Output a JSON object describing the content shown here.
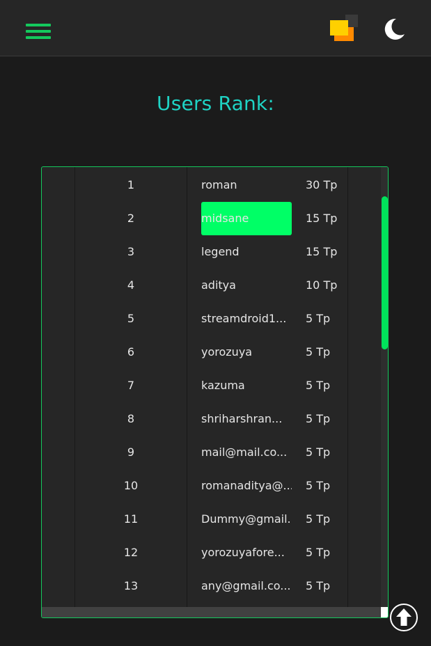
{
  "header": {
    "menu_icon": "hamburger-menu-icon",
    "logo_icon": "stacked-squares-logo",
    "theme_icon": "moon-icon",
    "accent_color": "#14c95d"
  },
  "page": {
    "title": "Users Rank:"
  },
  "leaderboard": {
    "highlight_color": "#00ff66",
    "rows": [
      {
        "rank": "1",
        "name": "roman",
        "points": "30 Tp"
      },
      {
        "rank": "2",
        "name": "midsane",
        "points": "15 Tp"
      },
      {
        "rank": "3",
        "name": "legend",
        "points": "15 Tp"
      },
      {
        "rank": "4",
        "name": "aditya",
        "points": "10 Tp"
      },
      {
        "rank": "5",
        "name": "streamdroid1...",
        "points": "5 Tp"
      },
      {
        "rank": "6",
        "name": "yorozuya",
        "points": "5 Tp"
      },
      {
        "rank": "7",
        "name": "kazuma",
        "points": "5 Tp"
      },
      {
        "rank": "8",
        "name": "shriharshran...",
        "points": "5 Tp"
      },
      {
        "rank": "9",
        "name": "mail@mail.co...",
        "points": "5 Tp"
      },
      {
        "rank": "10",
        "name": "romanaditya@...",
        "points": "5 Tp"
      },
      {
        "rank": "11",
        "name": "Dummy@gmail....",
        "points": "5 Tp"
      },
      {
        "rank": "12",
        "name": "yorozuyafore...",
        "points": "5 Tp"
      },
      {
        "rank": "13",
        "name": "any@gmail.co...",
        "points": "5 Tp"
      }
    ]
  },
  "footer": {
    "scroll_top_icon": "arrow-up-circle-icon"
  }
}
